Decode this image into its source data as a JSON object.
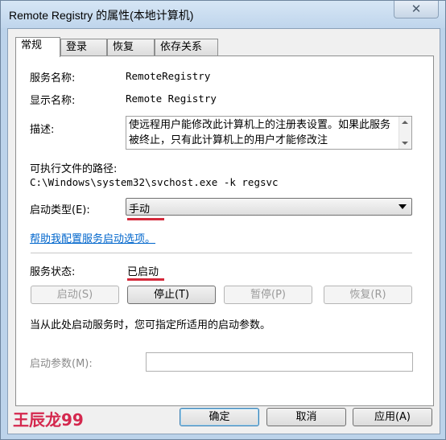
{
  "window": {
    "title": "Remote Registry 的属性(本地计算机)",
    "close_symbol": "✕"
  },
  "tabs": [
    {
      "label": "常规",
      "active": true
    },
    {
      "label": "登录",
      "active": false
    },
    {
      "label": "恢复",
      "active": false
    },
    {
      "label": "依存关系",
      "active": false
    }
  ],
  "general": {
    "service_name_label": "服务名称:",
    "service_name_value": "RemoteRegistry",
    "display_name_label": "显示名称:",
    "display_name_value": "Remote Registry",
    "description_label": "描述:",
    "description_value": "使远程用户能修改此计算机上的注册表设置。如果此服务被终止，只有此计算机上的用户才能修改注",
    "path_label": "可执行文件的路径:",
    "path_value": "C:\\Windows\\system32\\svchost.exe -k regsvc",
    "startup_type_label": "启动类型(E):",
    "startup_type_value": "手动",
    "help_link": "帮助我配置服务启动选项。",
    "status_label": "服务状态:",
    "status_value": "已启动",
    "start_button": "启动(S)",
    "stop_button": "停止(T)",
    "pause_button": "暂停(P)",
    "resume_button": "恢复(R)",
    "hint_text": "当从此处启动服务时，您可指定所适用的启动参数。",
    "start_params_label": "启动参数(M):",
    "start_params_value": ""
  },
  "footer": {
    "ok_button": "确定",
    "cancel_button": "取消",
    "apply_button": "应用(A)"
  },
  "watermark": {
    "signature": "王辰龙99"
  },
  "colors": {
    "accent_underline": "#d4283a",
    "link": "#0066cc",
    "signature": "#d4284e"
  }
}
